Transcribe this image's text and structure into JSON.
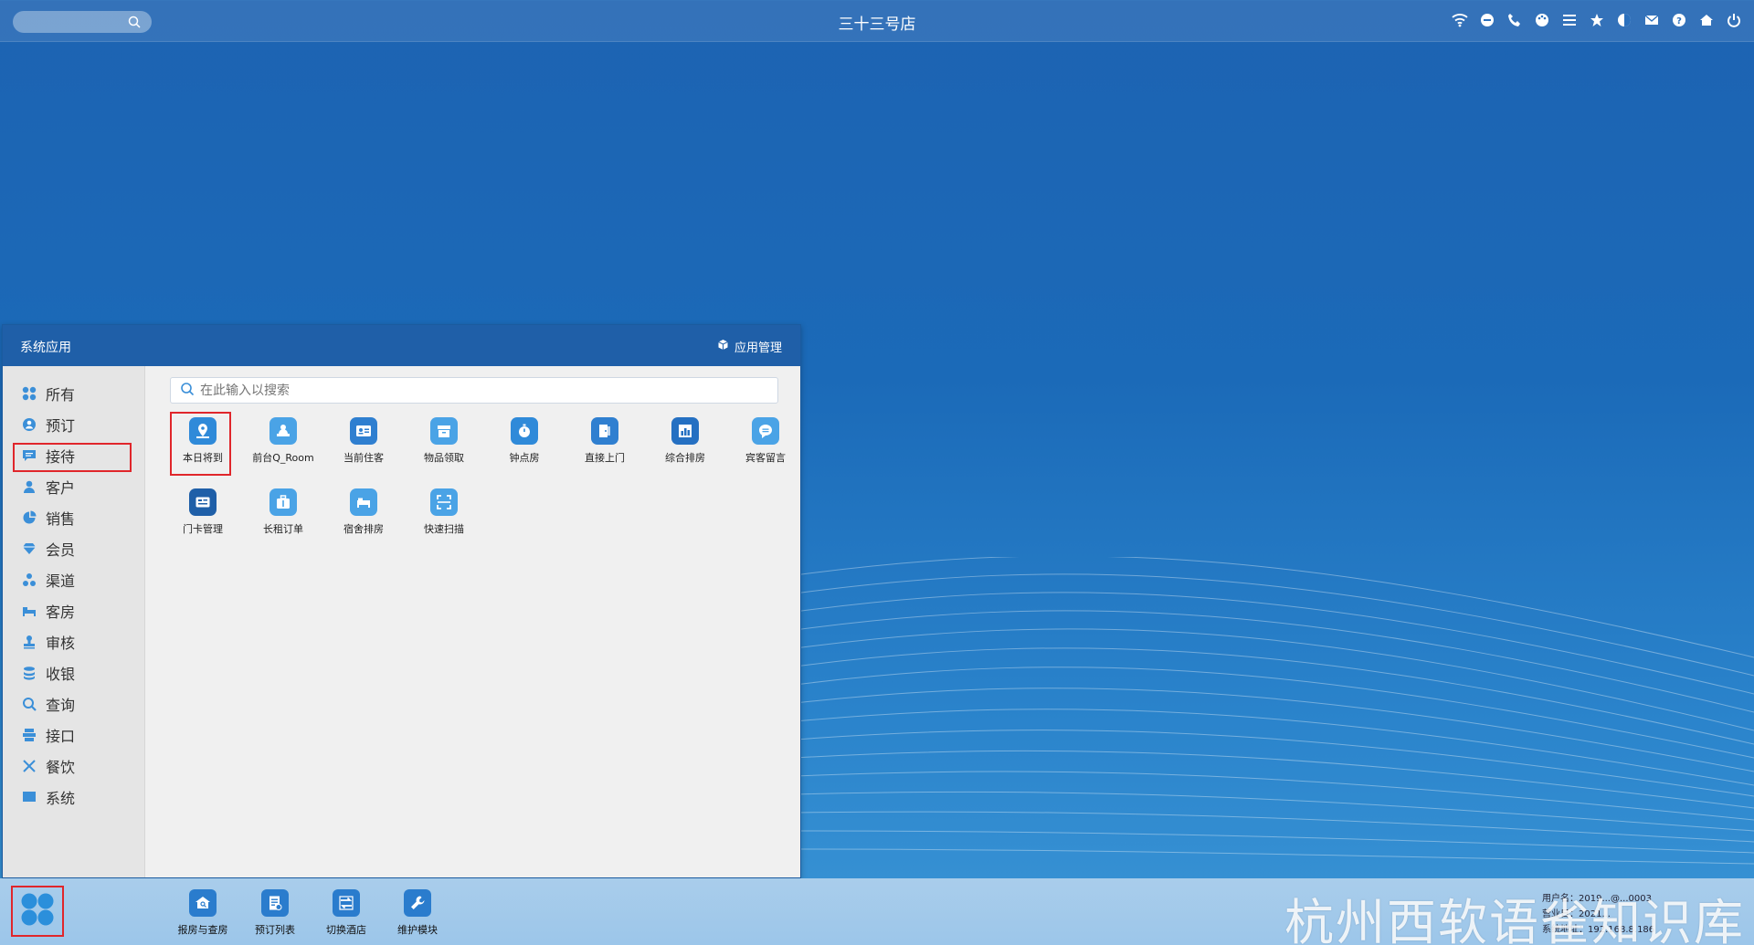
{
  "topbar": {
    "title": "三十三号店",
    "icons": [
      "wifi-icon",
      "chat-icon",
      "phone-icon",
      "palette-icon",
      "menu-icon",
      "star-icon",
      "contrast-icon",
      "mail-icon",
      "help-icon",
      "home-icon",
      "power-icon"
    ]
  },
  "app_window": {
    "title": "系统应用",
    "manage_label": "应用管理",
    "search_placeholder": "在此输入以搜索",
    "sidebar": [
      {
        "label": "所有",
        "icon": "grid-icon"
      },
      {
        "label": "预订",
        "icon": "user-circle-icon"
      },
      {
        "label": "接待",
        "icon": "message-icon"
      },
      {
        "label": "客户",
        "icon": "person-icon"
      },
      {
        "label": "销售",
        "icon": "pie-chart-icon"
      },
      {
        "label": "会员",
        "icon": "diamond-icon"
      },
      {
        "label": "渠道",
        "icon": "nodes-icon"
      },
      {
        "label": "客房",
        "icon": "bed-icon"
      },
      {
        "label": "审核",
        "icon": "stamp-icon"
      },
      {
        "label": "收银",
        "icon": "coins-icon"
      },
      {
        "label": "查询",
        "icon": "search-icon"
      },
      {
        "label": "接口",
        "icon": "interface-icon"
      },
      {
        "label": "餐饮",
        "icon": "utensils-icon"
      },
      {
        "label": "系统",
        "icon": "monitor-icon"
      }
    ],
    "apps": [
      {
        "label": "本日将到",
        "icon": "map-pin-icon"
      },
      {
        "label": "前台Q_Room",
        "icon": "reception-icon"
      },
      {
        "label": "当前住客",
        "icon": "id-card-icon"
      },
      {
        "label": "物品领取",
        "icon": "box-icon"
      },
      {
        "label": "钟点房",
        "icon": "stopwatch-icon"
      },
      {
        "label": "直接上门",
        "icon": "door-icon"
      },
      {
        "label": "综合排房",
        "icon": "room-plan-icon"
      },
      {
        "label": "宾客留言",
        "icon": "comment-icon"
      },
      {
        "label": "门卡管理",
        "icon": "card-icon"
      },
      {
        "label": "长租订单",
        "icon": "briefcase-icon"
      },
      {
        "label": "宿舍排房",
        "icon": "bed-icon"
      },
      {
        "label": "快速扫描",
        "icon": "scan-icon"
      }
    ]
  },
  "taskbar": {
    "items": [
      {
        "label": "报房与查房",
        "icon": "house-search-icon"
      },
      {
        "label": "预订列表",
        "icon": "list-icon"
      },
      {
        "label": "切换酒店",
        "icon": "switch-icon"
      },
      {
        "label": "维护模块",
        "icon": "wrench-icon"
      }
    ],
    "sys_info": [
      "用户名：2019...@...0003",
      "营业日：2021...",
      "系统地址：192.168.8.186"
    ],
    "watermark": "杭州西软语雀知识库"
  },
  "colors": {
    "accent": "#1f5fa8",
    "highlight": "#e0262b",
    "icon_blue": "#3b9be0"
  }
}
